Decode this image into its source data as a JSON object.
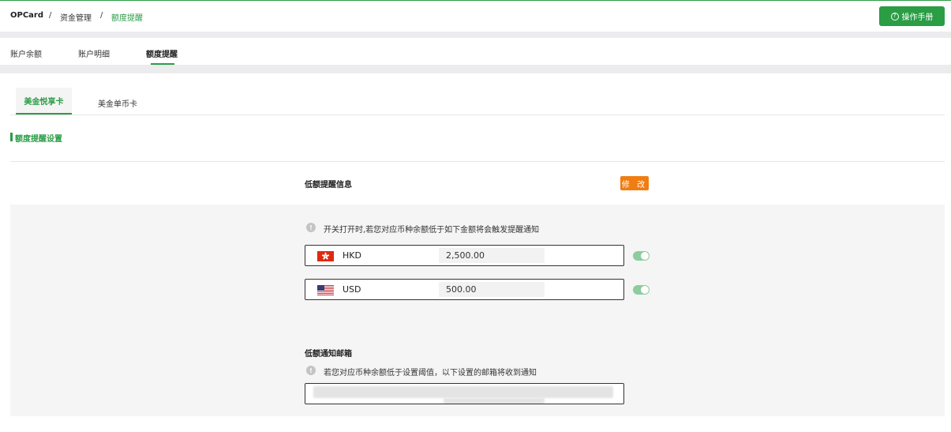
{
  "breadcrumb": {
    "root": "OPCard",
    "separator": "/",
    "level2": "资金管理",
    "current": "额度提醒"
  },
  "header": {
    "manual_label": "操作手册",
    "manual_icon": "?"
  },
  "tabs": [
    {
      "label": "账户余额"
    },
    {
      "label": "账户明细"
    },
    {
      "label": "额度提醒"
    }
  ],
  "card_tabs": [
    {
      "label": "美金悦享卡"
    },
    {
      "label": "美金单币卡"
    }
  ],
  "section_title": "额度提醒设置",
  "low_balance": {
    "title": "低额提醒信息",
    "edit_label": "修 改",
    "note": "开关打开时,若您对应币种余额低于如下金额将会触发提醒通知",
    "info_icon": "!",
    "currencies": [
      {
        "code": "HKD",
        "amount": "2,500.00",
        "flag": "hk-flag",
        "enabled": true
      },
      {
        "code": "USD",
        "amount": "500.00",
        "flag": "us-flag",
        "enabled": true
      }
    ]
  },
  "email": {
    "title": "低额通知邮箱",
    "note": "若您对应币种余额低于设置阈值，以下设置的邮箱将收到通知",
    "info_icon": "!"
  },
  "colors": {
    "brand_green": "#2a9d45",
    "edit_orange": "#f07d12",
    "toggle_on": "#8ccc9f"
  }
}
